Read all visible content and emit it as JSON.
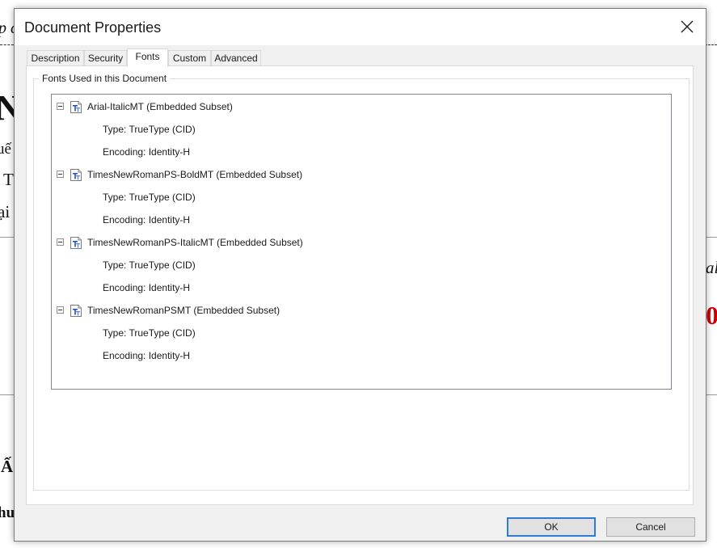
{
  "background": {
    "fragments": [
      "p c",
      "N",
      "uế",
      "T",
      "ại",
      "al",
      "0",
      "Ấ",
      "hu"
    ]
  },
  "dialog": {
    "title": "Document Properties",
    "tabs": [
      {
        "label": "Description",
        "active": false
      },
      {
        "label": "Security",
        "active": false
      },
      {
        "label": "Fonts",
        "active": true
      },
      {
        "label": "Custom",
        "active": false
      },
      {
        "label": "Advanced",
        "active": false
      }
    ],
    "group_label": "Fonts Used in this Document",
    "fonts": [
      {
        "name": "Arial-ItalicMT (Embedded Subset)",
        "type": "Type: TrueType (CID)",
        "encoding": "Encoding: Identity-H"
      },
      {
        "name": "TimesNewRomanPS-BoldMT (Embedded Subset)",
        "type": "Type: TrueType (CID)",
        "encoding": "Encoding: Identity-H"
      },
      {
        "name": "TimesNewRomanPS-ItalicMT (Embedded Subset)",
        "type": "Type: TrueType (CID)",
        "encoding": "Encoding: Identity-H"
      },
      {
        "name": "TimesNewRomanPSMT (Embedded Subset)",
        "type": "Type: TrueType (CID)",
        "encoding": "Encoding: Identity-H"
      }
    ],
    "buttons": {
      "ok": "OK",
      "cancel": "Cancel"
    },
    "icons": {
      "close": "close-icon",
      "font": "truetype-font-icon",
      "expander": "collapse-icon"
    },
    "colors": {
      "default_button_border": "#2d7bd4",
      "font_icon_blue": "#1f4fb8"
    }
  }
}
